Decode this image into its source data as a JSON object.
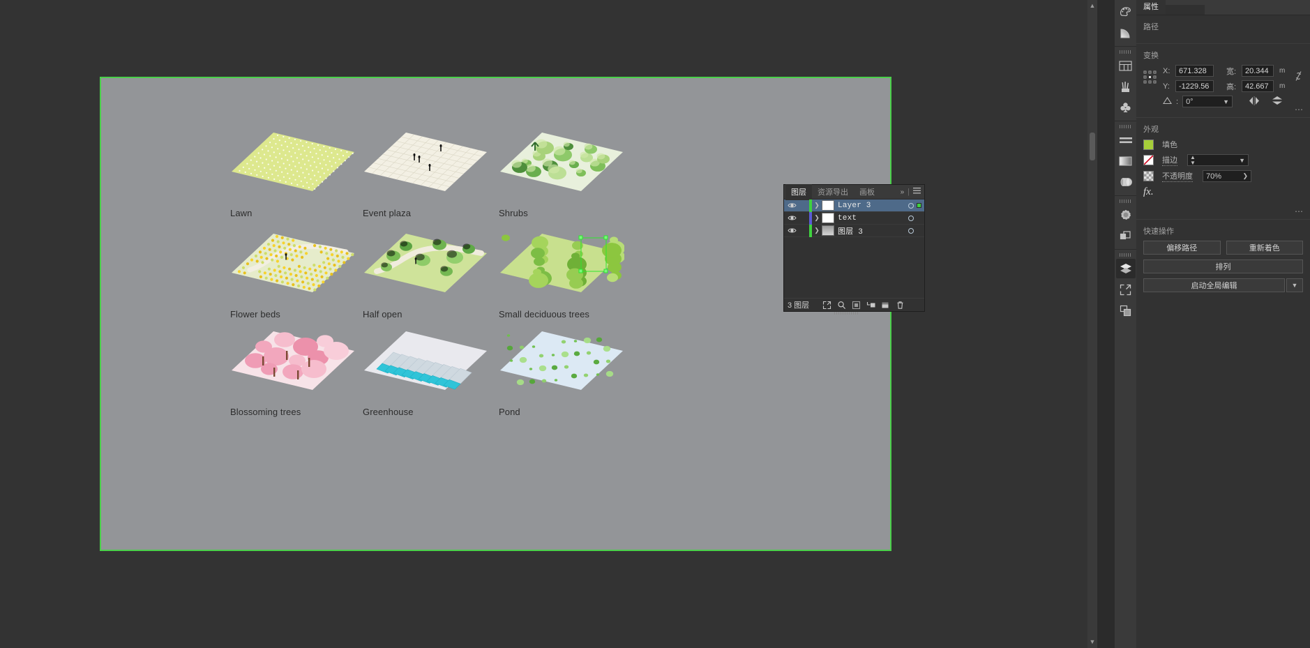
{
  "canvas": {
    "artboard_bg": "#939598",
    "artboard_border": "#4ad04a",
    "workspace_bg": "#333333",
    "tiles": [
      {
        "label": "Lawn",
        "icon": "lawn-tile"
      },
      {
        "label": "Event plaza",
        "icon": "event-plaza-tile"
      },
      {
        "label": "Shrubs",
        "icon": "shrubs-tile"
      },
      {
        "label": "Flower beds",
        "icon": "flower-beds-tile"
      },
      {
        "label": "Half open",
        "icon": "half-open-tile"
      },
      {
        "label": "Small deciduous trees",
        "icon": "small-deciduous-trees-tile"
      },
      {
        "label": "Blossoming trees",
        "icon": "blossoming-trees-tile"
      },
      {
        "label": "Greenhouse",
        "icon": "greenhouse-tile"
      },
      {
        "label": "Pond",
        "icon": "pond-tile"
      }
    ]
  },
  "properties": {
    "tabs": [
      {
        "label": "属性",
        "selected": true
      },
      {
        "label": "",
        "selected": false
      }
    ],
    "path_section": {
      "title": "路径"
    },
    "transform": {
      "title": "变换",
      "x_label": "X:",
      "x_value": "671.328",
      "y_label": "Y:",
      "y_value": "-1229.56",
      "w_label": "宽:",
      "w_value": "20.344",
      "w_unit": "m",
      "h_label": "高:",
      "h_value": "42.667",
      "h_unit": "m",
      "angle_value": "0°",
      "link_icon": "broken-link-icon",
      "flip_h_icon": "flip-horizontal-icon",
      "flip_v_icon": "flip-vertical-icon",
      "reference_point_icon": "reference-point-icon",
      "more_icon": "more-options-icon"
    },
    "appearance": {
      "title": "外观",
      "fill_label": "填色",
      "fill_color": "#a6ce39",
      "stroke_label": "描边",
      "stroke_icon": "no-stroke-icon",
      "stroke_weight": "",
      "opacity_label": "不透明度",
      "opacity_value": "70%",
      "fx_label": "fx.",
      "more_icon": "more-options-icon"
    },
    "quick_actions": {
      "title": "快速操作",
      "buttons": [
        {
          "label": "偏移路径"
        },
        {
          "label": "重新着色"
        },
        {
          "label": "排列"
        },
        {
          "label": "启动全局编辑",
          "has_dropdown": true
        }
      ]
    }
  },
  "layers_panel": {
    "tabs": [
      {
        "label": "图层",
        "selected": true
      },
      {
        "label": "资源导出",
        "selected": false
      },
      {
        "label": "画板",
        "selected": false
      }
    ],
    "collapse_icon": "double-chevron-right-icon",
    "menu_icon": "panel-menu-icon",
    "rows": [
      {
        "name": "Layer 3",
        "color": "#3fd23f",
        "selected": true,
        "visible": true,
        "thumb": "layer-thumb-art",
        "has_target_dot": true
      },
      {
        "name": "text",
        "color": "#5b5bd6",
        "selected": false,
        "visible": true,
        "thumb": "layer-thumb-text",
        "has_target_dot": false
      },
      {
        "name": "图层 3",
        "color": "#3fd23f",
        "selected": false,
        "visible": true,
        "thumb": "layer-thumb-gray",
        "has_target_dot": false
      }
    ],
    "footer": {
      "count_text": "3 图层",
      "icons": [
        "locate-object-icon",
        "search-layer-icon",
        "make-clipping-mask-icon",
        "create-sublayer-icon",
        "create-new-layer-icon",
        "delete-layer-icon"
      ]
    }
  },
  "icon_rail": {
    "groups": [
      {
        "icons": [
          "color-wheel-icon",
          "gradient-wedge-icon"
        ]
      },
      {
        "icons": [
          "artboards-icon",
          "brushes-icon",
          "symbols-icon"
        ]
      },
      {
        "icons": [
          "align-icon",
          "gradient-panel-icon",
          "3d-materials-icon"
        ]
      },
      {
        "icons": [
          "appearance-icon",
          "pathfinder-icon"
        ]
      },
      {
        "icons": [
          "layers-icon",
          "asset-export-icon",
          "artboard-panel-icon"
        ]
      }
    ],
    "active_icon": "layers-icon"
  }
}
